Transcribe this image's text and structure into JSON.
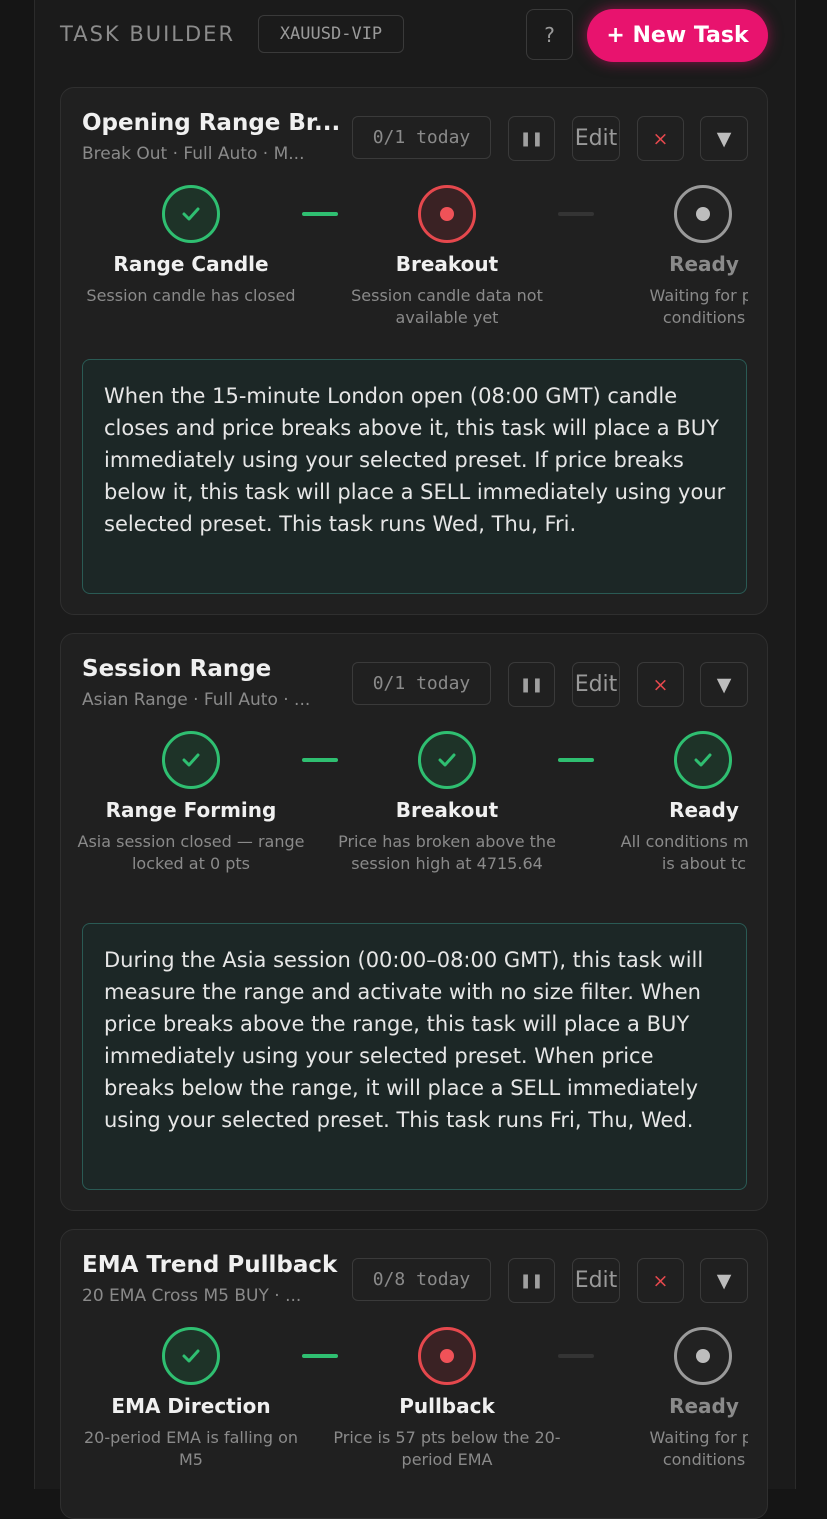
{
  "header": {
    "title": "TASK BUILDER",
    "symbol": "XAUUSD-VIP",
    "help_label": "?",
    "new_task_label": "+ New Task"
  },
  "colors": {
    "accent": "#e8136e",
    "done": "#2fbf71",
    "active": "#e5484d",
    "info_border": "#2a5a54"
  },
  "tasks": [
    {
      "title": "Opening Range Br...",
      "subtitle": "Break Out · Full Auto · M...",
      "counter": "0/1 today",
      "pause_icon": "pause-icon",
      "edit_label": "Edit",
      "delete_label": "×",
      "expand_label": "▼",
      "steps": [
        {
          "label": "Range Candle",
          "desc": "Session candle has closed",
          "state": "done"
        },
        {
          "label": "Breakout",
          "desc": "Session candle data not available yet",
          "state": "active"
        },
        {
          "label": "Ready",
          "desc": "Waiting for pr conditions",
          "state": "pending"
        }
      ],
      "info": "When the 15-minute London open (08:00 GMT) candle closes and price breaks above it, this task will place a BUY immediately using your selected preset. If price breaks below it, this task will place a SELL immediately using your selected preset. This task runs Wed, Thu, Fri."
    },
    {
      "title": "Session Range",
      "subtitle": "Asian Range · Full Auto · ...",
      "counter": "0/1 today",
      "pause_icon": "pause-icon",
      "edit_label": "Edit",
      "delete_label": "×",
      "expand_label": "▼",
      "steps": [
        {
          "label": "Range Forming",
          "desc": "Asia session closed — range locked at 0 pts",
          "state": "done"
        },
        {
          "label": "Breakout",
          "desc": "Price has broken above the session high at 4715.64",
          "state": "done"
        },
        {
          "label": "Ready",
          "desc": "All conditions m task is about tc",
          "state": "done"
        }
      ],
      "info": "During the Asia session (00:00–08:00 GMT), this task will measure the range and activate with no size filter. When price breaks above the range, this task will place a BUY immediately using your selected preset. When price breaks below the range, it will place a SELL immediately using your selected preset. This task runs Fri, Thu, Wed."
    },
    {
      "title": "EMA Trend Pullback",
      "subtitle": "20 EMA Cross M5 BUY · ...",
      "counter": "0/8 today",
      "pause_icon": "pause-icon",
      "edit_label": "Edit",
      "delete_label": "×",
      "expand_label": "▼",
      "steps": [
        {
          "label": "EMA Direction",
          "desc": "20-period EMA is falling on M5",
          "state": "done"
        },
        {
          "label": "Pullback",
          "desc": "Price is 57 pts below the 20-period EMA",
          "state": "active"
        },
        {
          "label": "Ready",
          "desc": "Waiting for pr conditions",
          "state": "pending"
        }
      ]
    }
  ]
}
